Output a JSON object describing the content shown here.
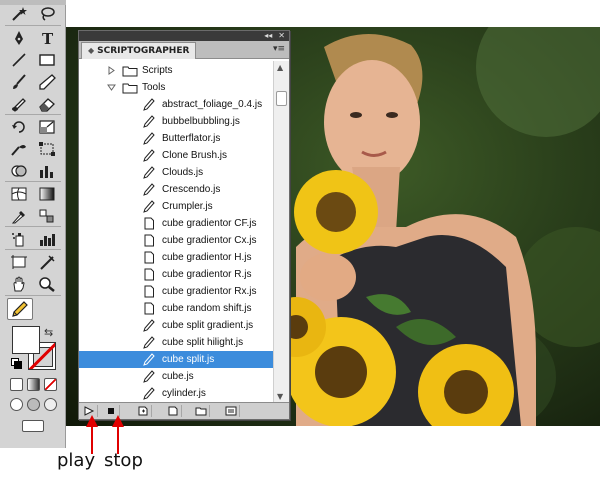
{
  "panel": {
    "title": "SCRIPTOGRAPHER",
    "topbar_arrows": "◂◂",
    "topbar_close": "✕",
    "menu_glyph": "▾≡"
  },
  "tree": {
    "folders": [
      {
        "label": "Scripts",
        "expanded": false
      },
      {
        "label": "Tools",
        "expanded": true
      }
    ],
    "items": [
      "abstract_foliage_0.4.js",
      "bubbelbubbling.js",
      "Butterflator.js",
      "Clone Brush.js",
      "Clouds.js",
      "Crescendo.js",
      "Crumpler.js",
      "cube gradientor CF.js",
      "cube gradientor Cx.js",
      "cube gradientor H.js",
      "cube gradientor R.js",
      "cube gradientor Rx.js",
      "cube random shift.js",
      "cube split gradient.js",
      "cube split hilight.js",
      "cube split.js",
      "cube.js",
      "cylinder.js"
    ],
    "selected_item": "cube split.js",
    "pencil_items": [
      "abstract_foliage_0.4.js",
      "bubbelbubbling.js",
      "Butterflator.js",
      "Clone Brush.js",
      "Clouds.js",
      "Crescendo.js",
      "Crumpler.js",
      "cube split gradient.js",
      "cube split hilight.js",
      "cube split.js",
      "cube.js",
      "cylinder.js"
    ],
    "page_items": [
      "cube gradientor CF.js",
      "cube gradientor Cx.js",
      "cube gradientor H.js",
      "cube gradientor R.js",
      "cube gradientor Rx.js",
      "cube random shift.js"
    ]
  },
  "bottom_bar": {
    "buttons": [
      "play-icon",
      "stop-icon",
      "new-script-icon",
      "new-file-icon",
      "new-folder-icon",
      "console-icon"
    ]
  },
  "annotations": {
    "play": "play",
    "stop": "stop",
    "arrow_color": "#e00000"
  },
  "colors": {
    "selection": "#3c8cdc",
    "panel_header": "#bdbdbd",
    "toolbox": "#d4d4d4"
  },
  "tools": [
    "magic-wand-icon",
    "lasso-icon",
    "pen-icon",
    "type-icon",
    "line-segment-icon",
    "rectangle-icon",
    "paintbrush-icon",
    "pencil-icon",
    "blob-brush-icon",
    "eraser-icon",
    "rotate-icon",
    "scale-icon",
    "warp-icon",
    "free-transform-icon",
    "shape-builder-icon",
    "perspective-grid-icon",
    "mesh-icon",
    "gradient-icon",
    "eyedropper-icon",
    "blend-icon",
    "symbol-sprayer-icon",
    "column-graph-icon",
    "artboard-icon",
    "slice-icon",
    "hand-icon",
    "zoom-icon",
    "scriptographer-pencil-icon"
  ]
}
